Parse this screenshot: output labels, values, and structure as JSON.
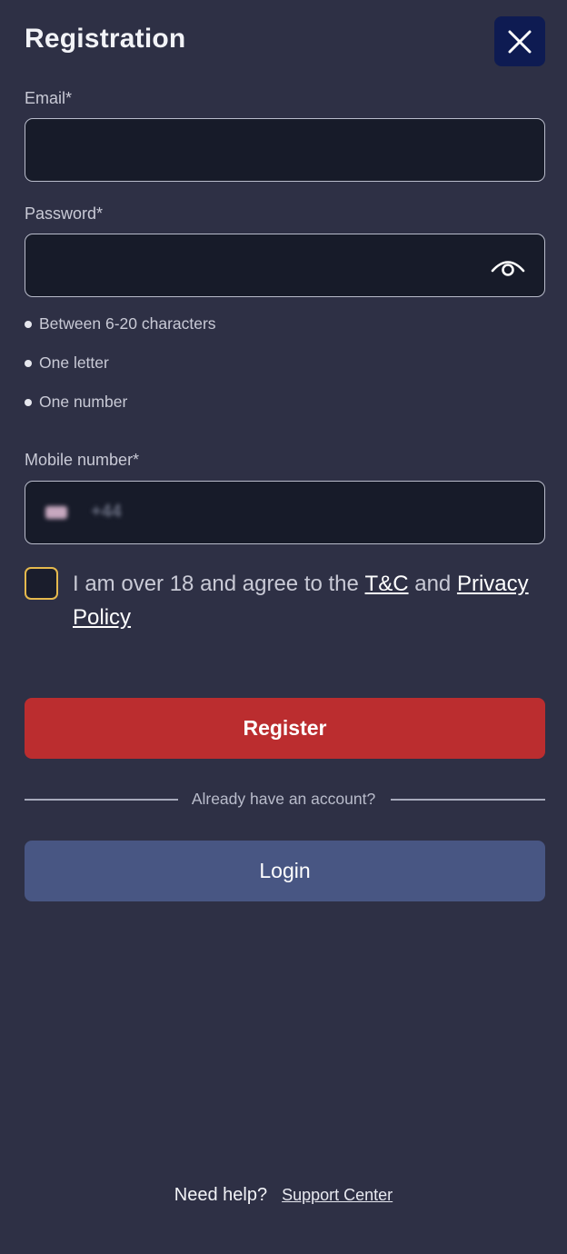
{
  "header": {
    "title": "Registration",
    "close_icon": "close-icon"
  },
  "email": {
    "label": "Email*",
    "value": "",
    "placeholder": ""
  },
  "password": {
    "label": "Password*",
    "value": "",
    "placeholder": "",
    "toggle_icon": "eye-icon",
    "requirements": [
      "Between 6-20 characters",
      "One letter",
      "One number"
    ]
  },
  "mobile": {
    "label": "Mobile number*",
    "country_code": "+44",
    "value": ""
  },
  "agreement": {
    "text_before": "I am over 18 and agree to the ",
    "tc_link": "T&C",
    "text_middle": " and ",
    "privacy_link": "Privacy Policy",
    "checked": false
  },
  "actions": {
    "register_label": "Register",
    "divider_text": "Already have an account?",
    "login_label": "Login"
  },
  "footer": {
    "help_text": "Need help?",
    "support_link": "Support Center"
  },
  "colors": {
    "background": "#2e3045",
    "register": "#bb2d2f",
    "login": "#485683",
    "close_button": "#0e1b52",
    "checkbox_border": "#e5b94d"
  }
}
